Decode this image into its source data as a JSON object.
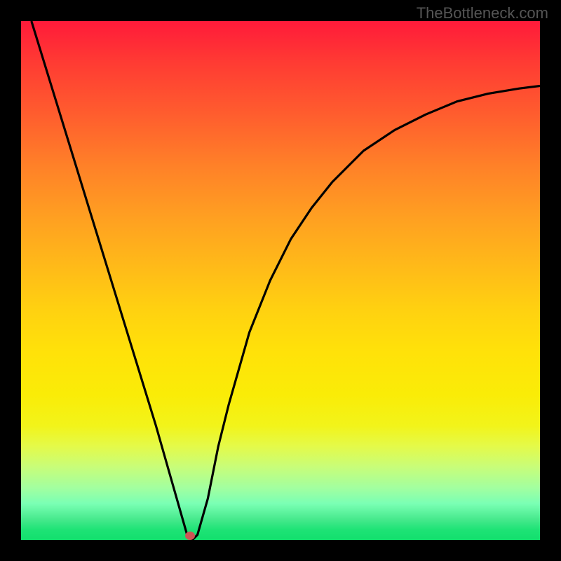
{
  "watermark": "TheBottleneck.com",
  "chart_data": {
    "type": "line",
    "title": "",
    "xlabel": "",
    "ylabel": "",
    "xlim": [
      0,
      100
    ],
    "ylim": [
      0,
      100
    ],
    "grid": false,
    "background_gradient": {
      "stops": [
        {
          "pos": 0,
          "color": "#ff1a3a"
        },
        {
          "pos": 18,
          "color": "#ff5d2e"
        },
        {
          "pos": 38,
          "color": "#ffa021"
        },
        {
          "pos": 56,
          "color": "#ffd210"
        },
        {
          "pos": 72,
          "color": "#faec07"
        },
        {
          "pos": 86,
          "color": "#c7fd7a"
        },
        {
          "pos": 96,
          "color": "#47e98d"
        },
        {
          "pos": 100,
          "color": "#12df6d"
        }
      ],
      "description": "vertical gradient from red (top, high bottleneck) to green (bottom, no bottleneck)"
    },
    "series": [
      {
        "name": "bottleneck-curve",
        "description": "V-shaped bottleneck curve with minimum near x=32, left branch linear descending, right branch concave ascending",
        "x": [
          2,
          6,
          10,
          14,
          18,
          22,
          26,
          30,
          32,
          33,
          34,
          36,
          38,
          40,
          44,
          48,
          52,
          56,
          60,
          66,
          72,
          78,
          84,
          90,
          96,
          100
        ],
        "y": [
          100,
          87,
          74,
          61,
          48,
          35,
          22,
          8,
          1,
          0,
          1,
          8,
          18,
          26,
          40,
          50,
          58,
          64,
          69,
          75,
          79,
          82,
          84.5,
          86,
          87,
          87.5
        ]
      }
    ],
    "minimum_point": {
      "x": 32.5,
      "y": 0,
      "color": "#cc5555"
    }
  },
  "plot": {
    "minimum_dot_left_pct": 32.5,
    "minimum_dot_top_pct": 99.2
  }
}
